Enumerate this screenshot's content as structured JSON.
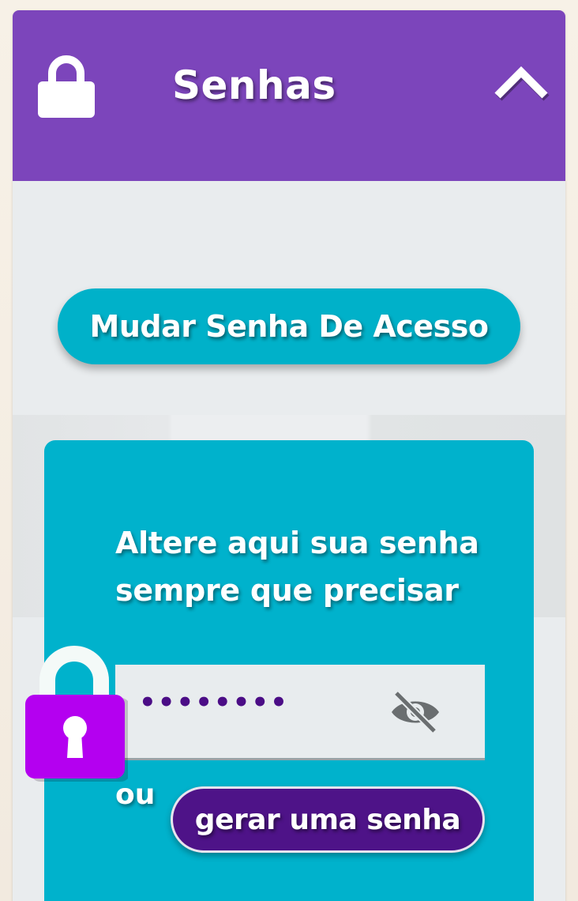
{
  "header": {
    "title": "Senhas",
    "lock_icon": "lock-icon",
    "collapse_icon": "chevron-up-icon"
  },
  "actions": {
    "change_password_label": "Mudar Senha De Acesso"
  },
  "card": {
    "heading": "Altere aqui sua senha sempre que precisar",
    "password_value": "••••••••",
    "visibility_icon": "eye-off-icon",
    "or_label": "ou",
    "generate_label": "gerar uma senha"
  },
  "colors": {
    "header_bg": "#7c45bb",
    "accent_cyan": "#00b2cc",
    "button_purple": "#4e1388",
    "lock_magenta": "#b400f0"
  }
}
